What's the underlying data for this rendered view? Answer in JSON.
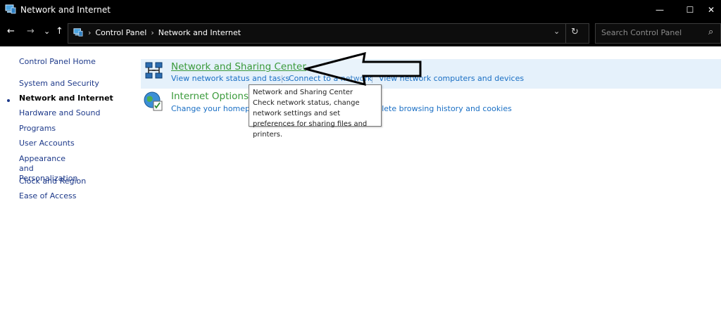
{
  "window": {
    "title": "Network and Internet",
    "minimize_label": "—",
    "maximize_label": "☐",
    "close_label": "✕"
  },
  "nav": {
    "back": "←",
    "forward": "→",
    "recent": "⌄",
    "up": "↑",
    "dropdown": "⌄",
    "refresh": "↻",
    "search_glyph": "⌕"
  },
  "breadcrumb": {
    "separator": "›",
    "items": [
      "Control Panel",
      "Network and Internet"
    ]
  },
  "search": {
    "placeholder": "Search Control Panel"
  },
  "sidebar": {
    "home": "Control Panel Home",
    "items": [
      {
        "label": "System and Security"
      },
      {
        "label": "Network and Internet",
        "active": true
      },
      {
        "label": "Hardware and Sound"
      },
      {
        "label": "Programs"
      },
      {
        "label": "User Accounts"
      },
      {
        "label": "Appearance and Personalization"
      },
      {
        "label": "Clock and Region"
      },
      {
        "label": "Ease of Access"
      }
    ]
  },
  "categories": [
    {
      "title": "Network and Sharing Center",
      "icon": "network-sharing-icon",
      "tasks": [
        "View network status and tasks",
        "Connect to a network",
        "View network computers and devices"
      ]
    },
    {
      "title": "Internet Options",
      "icon": "internet-options-icon",
      "tasks": [
        "Change your homepage",
        "Delete browsing history and cookies"
      ]
    }
  ],
  "tooltip": {
    "title": "Network and Sharing Center",
    "body": "Check network status, change network settings and set preferences for sharing files and printers."
  },
  "colors": {
    "titlebar": "#000000",
    "link": "#1a6fc4",
    "category_title": "#3a9a3a",
    "hover_background": "#e5f1fb",
    "sidebar_link": "#1e3a8a"
  }
}
